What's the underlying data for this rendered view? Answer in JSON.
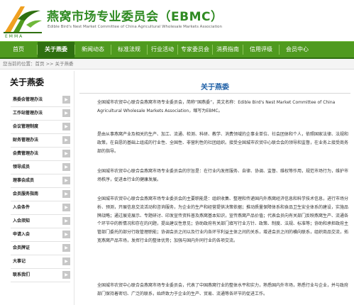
{
  "header": {
    "logo_word": "EMMA",
    "title_cn": "燕窝市场专业委员会（EBMC）",
    "title_en": "Edible Bird's Nest Market Committee of China Agricultural Wholesale Markets Association"
  },
  "nav": [
    {
      "label": "首页"
    },
    {
      "label": "关于燕委"
    },
    {
      "label": "新闻动态"
    },
    {
      "label": "标准法规"
    },
    {
      "label": "行业活动"
    },
    {
      "label": "专家委员会"
    },
    {
      "label": "消费指南"
    },
    {
      "label": "信用评级"
    },
    {
      "label": "会员中心"
    }
  ],
  "breadcrumb": "您当前的位置：首页 >> 关于燕委",
  "sidebar": {
    "title": "关于燕委",
    "items": [
      {
        "label": "燕委会管理办法"
      },
      {
        "label": "工作站管理办法"
      },
      {
        "label": "会议管理制度"
      },
      {
        "label": "财务管理办法"
      },
      {
        "label": "会费管理办法"
      },
      {
        "label": "领导成员"
      },
      {
        "label": "理事会成员"
      },
      {
        "label": "会员服务指南"
      },
      {
        "label": "入会条件"
      },
      {
        "label": "入会须知"
      },
      {
        "label": "申请入会"
      },
      {
        "label": "会员牌证"
      },
      {
        "label": "大事记"
      },
      {
        "label": "联系我们"
      }
    ]
  },
  "content": {
    "title": "关于燕委",
    "paragraphs": [
      "全国城市农贸中心联合会燕窝市场专业委员会，简称“国燕委”，英文名称：Edible Bird's Nest Market Committee of China Agricultural Wholesale Markets Association，缩写为EBMC。",
      "是由从事燕窝产业及相关的生产、加工、流通、检测、科研、教学、消费领域的企事业单位、社会团体和个人，依照国家法律、法规和政策，在自愿的基础上组成的行业性、全国性、非营利性的社团组织。接受全国城市农贸中心联合会的领导和监督，在业务上接受商务部的指导。",
      "全国城市农贸中心联合会燕窝市场专业委员会的宗旨是：在行业内发挥服务、自律、协调、监督、维权等作用，规范市场行为，维护市场秩序，促进本行业的健康发展。",
      "全国城市农贸中心联合会燕窝市场专业委员会的主要职能是：组织收集、整理和传递国内外燕窝经济信息和科学技术信息，进行市场分析、预测，开展信息交流活动和咨询服务，为企业的生产和经营提供决策依据；推动质量保障体系和食品卫生安全体系的建设，实施品牌战略；通过展览展示、专题研讨、印发宣传资料普及燕窝基本知识，宣传燕窝产品价值；代表会员向有关部门反映燕窝生产、流通各个环节中的新情况和存在的问题，提出建议性意见；协助政府有关部门填写行业方针、政策、制度、法规、标准等；协助和承担政府主管部门委托的部分行政管理职能；协调会员之间以及行业内各环节利益主体之间的关系，增进会员之间的横向联系，组织商品交流，拓宽燕窝产品市场，发挥行业的整体优势；加强与国内外同行业的各项交流。",
      "全国城市农贸中心联合会燕窝市场专业委员会，代表了中国燕窝行业的整体水平和实力，熟悉国内外市场，熟悉行业与企业，并与政府部门保持着密切、广泛的联系，始终致力于企业的生产、贸易、流通等各环节的促进工作。"
    ]
  },
  "colors": {
    "brand_green": "#4f9a1f",
    "nav_active": "#2f7011",
    "title_blue": "#1e5fa6",
    "logo_orange": "#f0a020"
  }
}
